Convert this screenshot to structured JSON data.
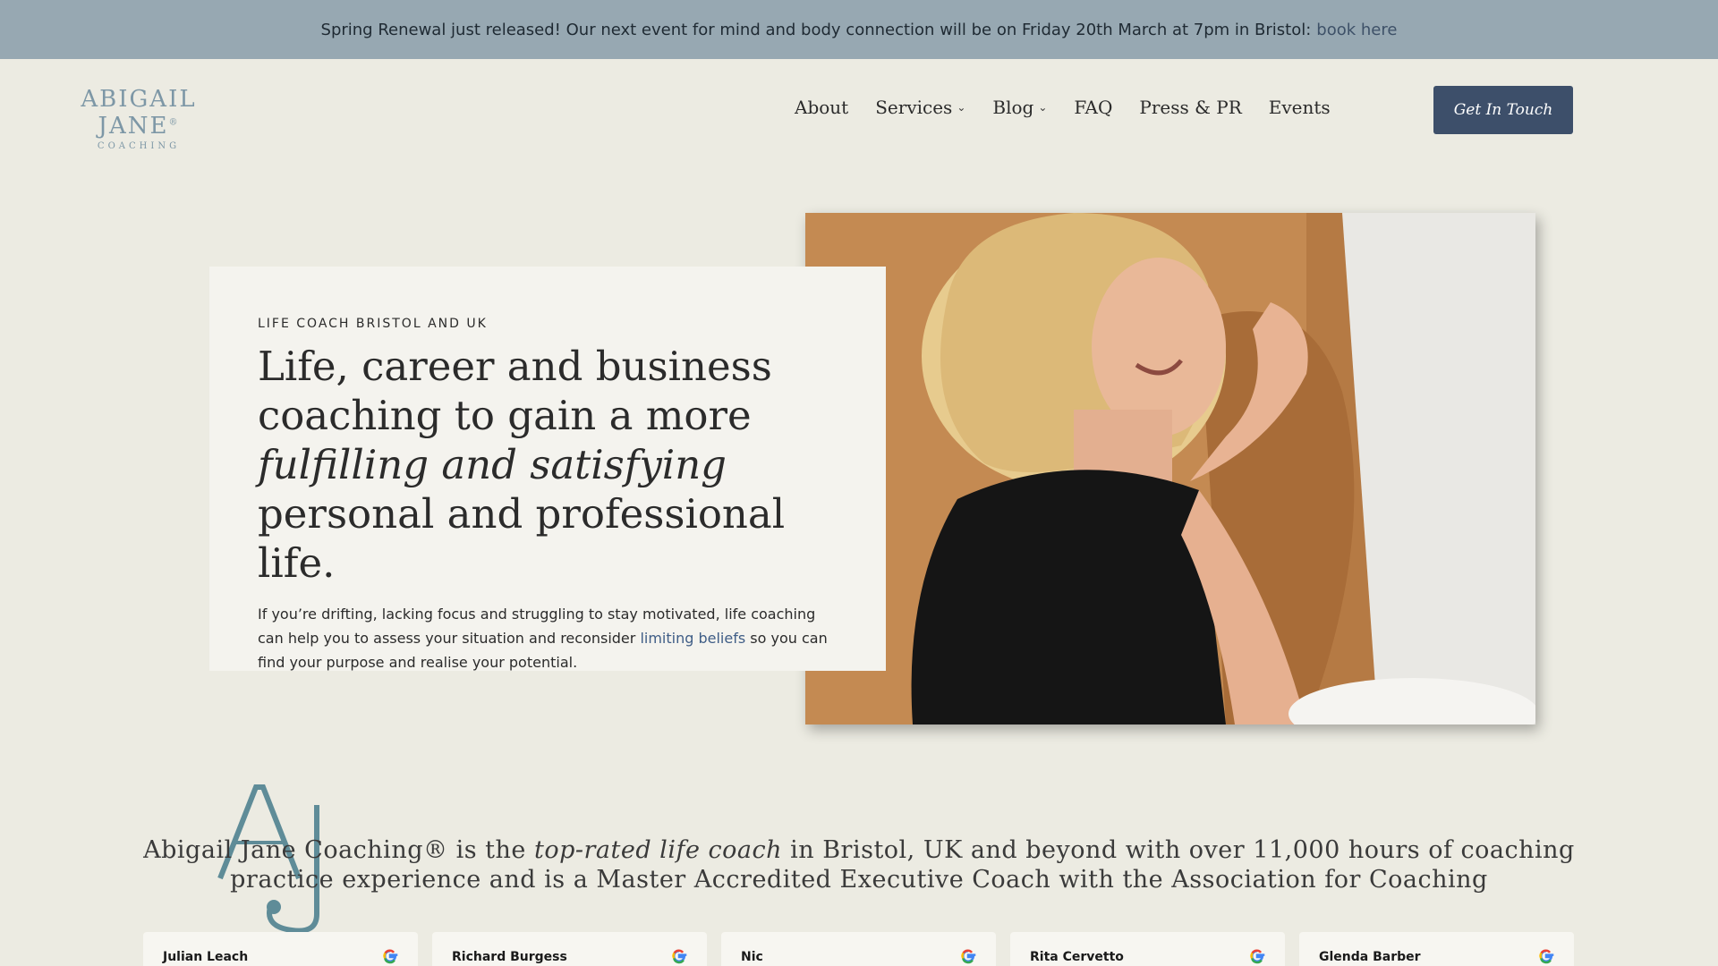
{
  "announcement": {
    "text": "Spring Renewal just released! Our next event for mind and body connection will be on Friday 20th March at 7pm in Bristol:",
    "link": "book here"
  },
  "logo": {
    "main": "ABIGAIL JANE",
    "sup": "®",
    "sub": "COACHING"
  },
  "nav": {
    "items": [
      {
        "label": "About",
        "dropdown": false
      },
      {
        "label": "Services",
        "dropdown": true
      },
      {
        "label": "Blog",
        "dropdown": true
      },
      {
        "label": "FAQ",
        "dropdown": false
      },
      {
        "label": "Press & PR",
        "dropdown": false
      },
      {
        "label": "Events",
        "dropdown": false
      }
    ],
    "cta": "Get In Touch"
  },
  "hero": {
    "eyebrow": "LIFE COACH BRISTOL AND UK",
    "headline_part1": "Life, career and business coaching to gain a more",
    "headline_italic": "fulfilling and satisfying",
    "headline_part2": "personal and professional life.",
    "lede_part1": "If you’re drifting, lacking focus and struggling to stay motivated, life coaching can help you to assess your situation and reconsider",
    "lede_link": "limiting beliefs",
    "lede_part2": "so you can find your purpose and realise your potential."
  },
  "tagline": {
    "part1": "Abigail Jane Coaching® is the",
    "italic": "top-rated life coach",
    "part2": "in Bristol, UK and beyond with over 11,000 hours of coaching practice experience and is a Master Accredited Executive Coach with the Association for Coaching"
  },
  "reviews": [
    {
      "name": "Julian Leach"
    },
    {
      "name": "Richard Burgess"
    },
    {
      "name": "Nic"
    },
    {
      "name": "Rita Cervetto"
    },
    {
      "name": "Glenda Barber"
    }
  ],
  "colors": {
    "announcement_bg": "#97a8b2",
    "page_bg": "#ecebe2",
    "cta_bg": "#3d4f6a",
    "link": "#3f5d86",
    "logo": "#7d97a6"
  },
  "icons": {
    "review_source": "google-g-icon",
    "dropdown": "chevron-down-icon"
  }
}
